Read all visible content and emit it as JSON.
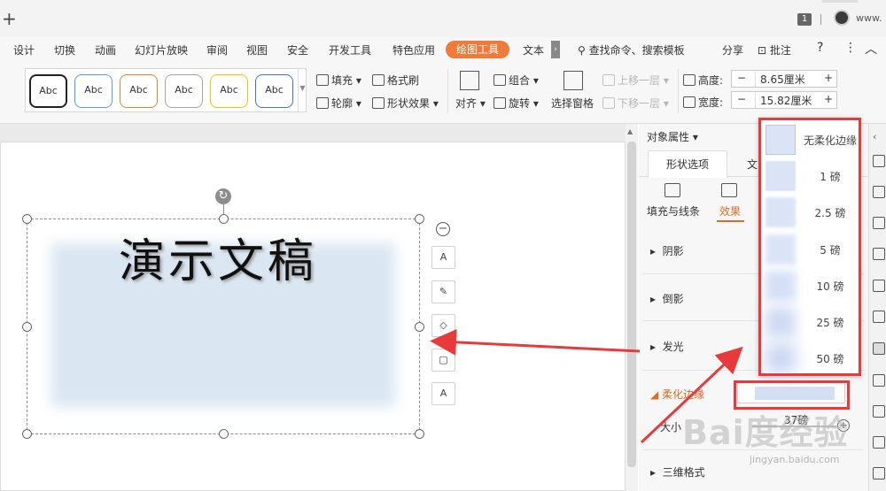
{
  "titlebar": {
    "tab_count": "1",
    "user": "www."
  },
  "menu": {
    "items": [
      "设计",
      "切换",
      "动画",
      "幻灯片放映",
      "审阅",
      "视图",
      "安全",
      "开发工具",
      "特色应用"
    ],
    "active": "绘图工具",
    "truncated": "文本",
    "search": "查找命令、搜索模板",
    "share": "分享",
    "comment": "批注",
    "help": "?"
  },
  "ribbon": {
    "style_label": "Abc",
    "style_colors": [
      "#222222",
      "#5b9bd5",
      "#ed7d31",
      "#a5a5a5",
      "#ffc000",
      "#4472c4"
    ],
    "fill": "填充",
    "format_painter": "格式刷",
    "outline": "轮廓",
    "shape_effect": "形状效果",
    "align": "对齐",
    "group": "组合",
    "rotate": "旋转",
    "selection_pane": "选择窗格",
    "bring_forward": "上移一层",
    "send_backward": "下移一层",
    "height_label": "高度:",
    "height_value": "8.65厘米",
    "width_label": "宽度:",
    "width_value": "15.82厘米",
    "minus": "−",
    "plus": "+"
  },
  "slide": {
    "text": "演示文稿",
    "collapse": "−",
    "tool_text": "A"
  },
  "panel": {
    "title": "对象属性",
    "tab_shape": "形状选项",
    "tab_text": "文",
    "sub_fill": "填充与线条",
    "sub_effect": "效果",
    "sections": [
      "阴影",
      "倒影",
      "发光",
      "柔化边缘",
      "三维格式"
    ],
    "size_label": "大小",
    "size_value": "37磅"
  },
  "soft_edge_menu": {
    "items": [
      "无柔化边缘",
      "1 磅",
      "2.5 磅",
      "5 磅",
      "10 磅",
      "25 磅",
      "50 磅"
    ]
  },
  "watermark": {
    "brand": "Bai度经验",
    "url": "jingyan.baidu.com"
  },
  "colors": {
    "accent": "#f07a3a",
    "highlight": "#e83a3a",
    "shape_fill": "#dbe6f3"
  }
}
